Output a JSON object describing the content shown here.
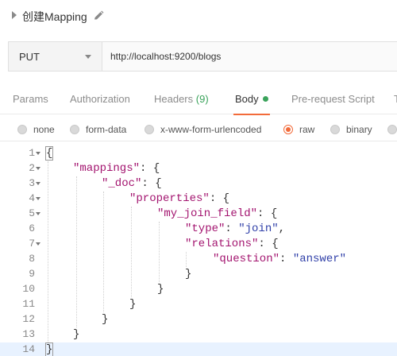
{
  "request": {
    "title": "创建Mapping",
    "method": "PUT",
    "url": "http://localhost:9200/blogs"
  },
  "tabs": [
    {
      "label": "Params"
    },
    {
      "label": "Authorization"
    },
    {
      "label": "Headers",
      "count": "(9)"
    },
    {
      "label": "Body",
      "active": true
    },
    {
      "label": "Pre-request Script"
    },
    {
      "label": "T"
    }
  ],
  "body_types": [
    {
      "label": "none"
    },
    {
      "label": "form-data"
    },
    {
      "label": "x-www-form-urlencoded"
    },
    {
      "label": "raw",
      "selected": true
    },
    {
      "label": "binary"
    }
  ],
  "editor": {
    "lines": [
      {
        "n": "1",
        "fold": true
      },
      {
        "n": "2",
        "fold": true,
        "key": "\"mappings\"",
        "tail": ": {"
      },
      {
        "n": "3",
        "fold": true,
        "key": "\"_doc\"",
        "tail": ": {"
      },
      {
        "n": "4",
        "fold": true,
        "key": "\"properties\"",
        "tail": ": {"
      },
      {
        "n": "5",
        "fold": true,
        "key": "\"my_join_field\"",
        "tail": ": {"
      },
      {
        "n": "6",
        "fold": false,
        "key": "\"type\"",
        "tail": ": ",
        "value": "\"join\"",
        "end": ","
      },
      {
        "n": "7",
        "fold": true,
        "key": "\"relations\"",
        "tail": ": {"
      },
      {
        "n": "8",
        "fold": false,
        "key": "\"question\"",
        "tail": ": ",
        "value": "\"answer\""
      },
      {
        "n": "9",
        "fold": false,
        "text": "}"
      },
      {
        "n": "10",
        "fold": false,
        "text": "}"
      },
      {
        "n": "11",
        "fold": false,
        "text": "}"
      },
      {
        "n": "12",
        "fold": false,
        "text": "}"
      },
      {
        "n": "13",
        "fold": false,
        "text": "}"
      },
      {
        "n": "14",
        "fold": false,
        "text": "}"
      }
    ],
    "open_brace": "{"
  },
  "colors": {
    "accent": "#f26b3a",
    "key": "#a3146f",
    "string": "#2f3fa8",
    "ok": "#3aa35b"
  }
}
